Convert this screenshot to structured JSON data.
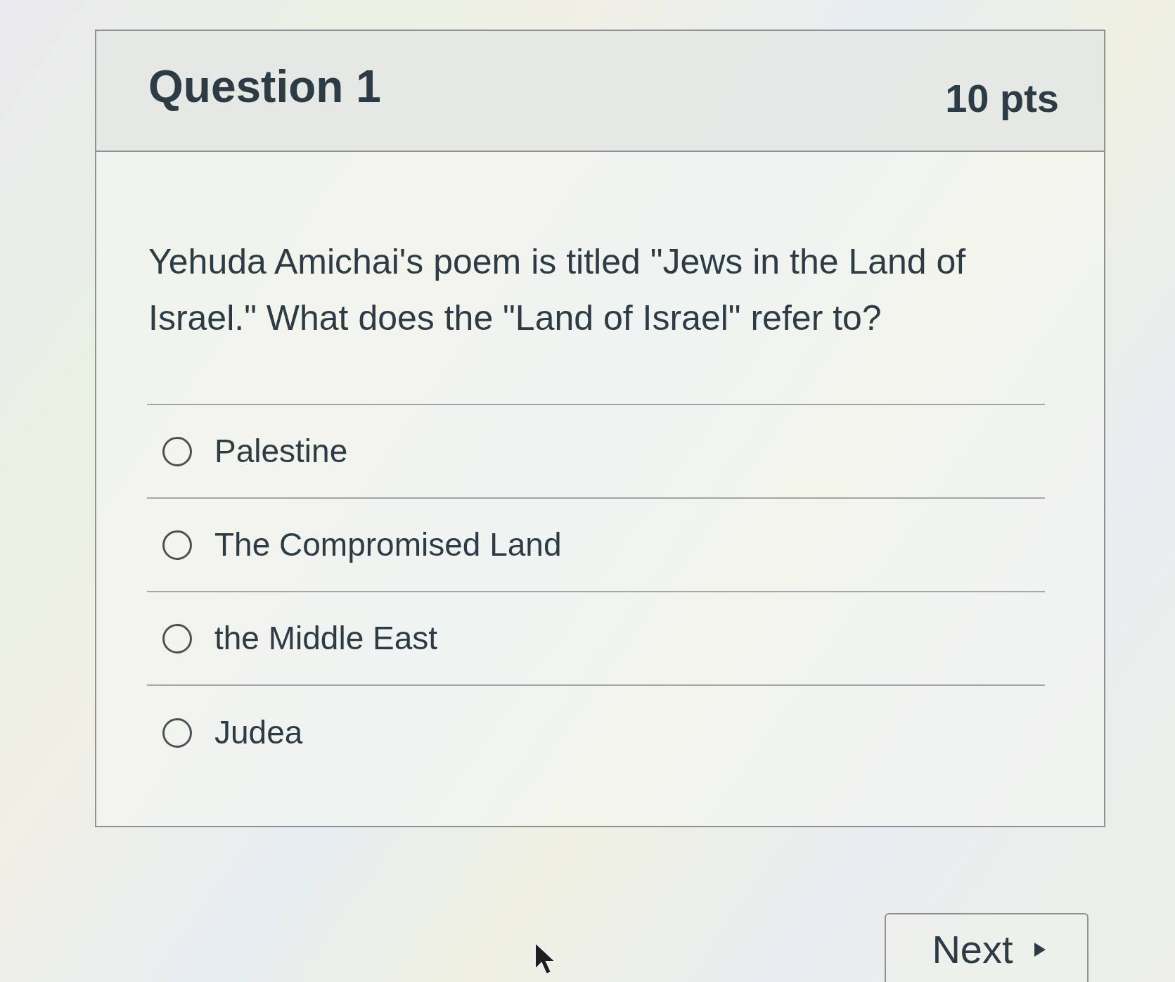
{
  "question": {
    "title": "Question 1",
    "points": "10 pts",
    "text": "Yehuda Amichai's poem is titled \"Jews in the Land of Israel.\" What does the \"Land of Israel\" refer to?"
  },
  "answers": [
    {
      "label": "Palestine",
      "selected": false
    },
    {
      "label": "The Compromised Land",
      "selected": false
    },
    {
      "label": "the Middle East",
      "selected": false
    },
    {
      "label": "Judea",
      "selected": false
    }
  ],
  "buttons": [
    {
      "label": "Next"
    }
  ]
}
